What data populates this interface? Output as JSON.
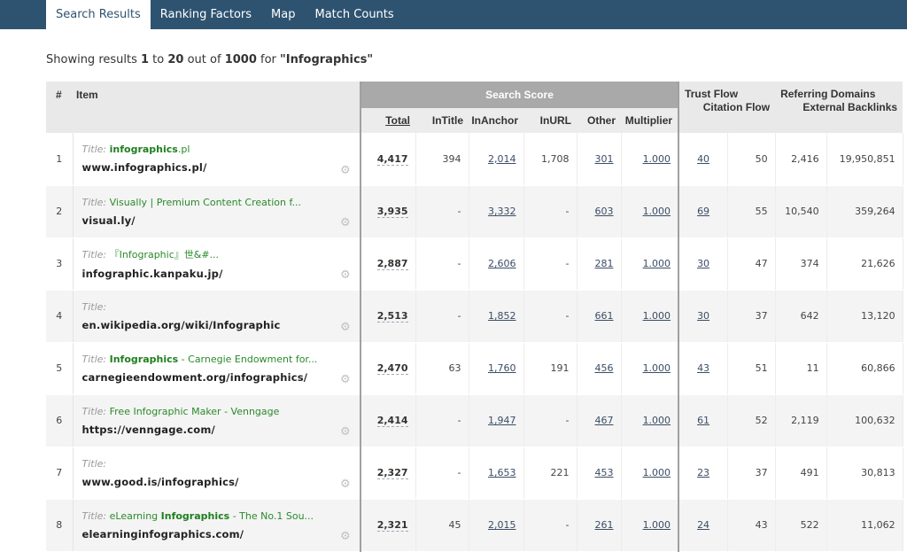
{
  "tabs": [
    {
      "label": "Search Results",
      "active": true
    },
    {
      "label": "Ranking Factors",
      "active": false
    },
    {
      "label": "Map",
      "active": false
    },
    {
      "label": "Match Counts",
      "active": false
    }
  ],
  "summary": {
    "prefix": "Showing results ",
    "from": "1",
    "to_word": " to ",
    "to": "20",
    "out_of_word": " out of ",
    "total": "1000",
    "for_word": " for ",
    "query": "\"Infographics\""
  },
  "table": {
    "headers": {
      "hash": "#",
      "item": "Item",
      "search_score": "Search Score",
      "total": "Total",
      "in_title": "InTitle",
      "in_anchor": "InAnchor",
      "in_url": "InURL",
      "other": "Other",
      "multiplier": "Multiplier",
      "trust_flow": "Trust Flow",
      "citation_flow": "Citation Flow",
      "referring_domains": "Referring Domains",
      "external_backlinks": "External Backlinks"
    },
    "title_label": "Title:",
    "rows": [
      {
        "num": "1",
        "title_parts": [
          {
            "t": "infographics",
            "b": true
          },
          {
            "t": ".pl",
            "b": false
          }
        ],
        "url": "www.infographics.pl/",
        "total": "4,417",
        "in_title": "394",
        "in_anchor": "2,014",
        "in_url": "1,708",
        "other": "301",
        "multiplier": "1.000",
        "trust_flow": "40",
        "citation_flow": "50",
        "referring_domains": "2,416",
        "external_backlinks": "19,950,851"
      },
      {
        "num": "2",
        "title_parts": [
          {
            "t": "Visually | Premium Content Creation f...",
            "b": false
          }
        ],
        "url": "visual.ly/",
        "total": "3,935",
        "in_title": "-",
        "in_anchor": "3,332",
        "in_url": "-",
        "other": "603",
        "multiplier": "1.000",
        "trust_flow": "69",
        "citation_flow": "55",
        "referring_domains": "10,540",
        "external_backlinks": "359,264"
      },
      {
        "num": "3",
        "title_parts": [
          {
            "t": "『Infographic』世&#...",
            "b": false
          }
        ],
        "url": "infographic.kanpaku.jp/",
        "total": "2,887",
        "in_title": "-",
        "in_anchor": "2,606",
        "in_url": "-",
        "other": "281",
        "multiplier": "1.000",
        "trust_flow": "30",
        "citation_flow": "47",
        "referring_domains": "374",
        "external_backlinks": "21,626"
      },
      {
        "num": "4",
        "title_parts": [],
        "url": "en.wikipedia.org/wiki/Infographic",
        "total": "2,513",
        "in_title": "-",
        "in_anchor": "1,852",
        "in_url": "-",
        "other": "661",
        "multiplier": "1.000",
        "trust_flow": "30",
        "citation_flow": "37",
        "referring_domains": "642",
        "external_backlinks": "13,120"
      },
      {
        "num": "5",
        "title_parts": [
          {
            "t": "Infographics",
            "b": true
          },
          {
            "t": " - Carnegie Endowment for...",
            "b": false
          }
        ],
        "url": "carnegieendowment.org/infographics/",
        "total": "2,470",
        "in_title": "63",
        "in_anchor": "1,760",
        "in_url": "191",
        "other": "456",
        "multiplier": "1.000",
        "trust_flow": "43",
        "citation_flow": "51",
        "referring_domains": "11",
        "external_backlinks": "60,866"
      },
      {
        "num": "6",
        "title_parts": [
          {
            "t": "Free Infographic Maker - Venngage",
            "b": false
          }
        ],
        "url": "https://venngage.com/",
        "total": "2,414",
        "in_title": "-",
        "in_anchor": "1,947",
        "in_url": "-",
        "other": "467",
        "multiplier": "1.000",
        "trust_flow": "61",
        "citation_flow": "52",
        "referring_domains": "2,119",
        "external_backlinks": "100,632"
      },
      {
        "num": "7",
        "title_parts": [],
        "url": "www.good.is/infographics/",
        "total": "2,327",
        "in_title": "-",
        "in_anchor": "1,653",
        "in_url": "221",
        "other": "453",
        "multiplier": "1.000",
        "trust_flow": "23",
        "citation_flow": "37",
        "referring_domains": "491",
        "external_backlinks": "30,813"
      },
      {
        "num": "8",
        "title_parts": [
          {
            "t": "eLearning ",
            "b": false
          },
          {
            "t": "Infographics",
            "b": true
          },
          {
            "t": " - The No.1 Sou...",
            "b": false
          }
        ],
        "url": "elearninginfographics.com/",
        "total": "2,321",
        "in_title": "45",
        "in_anchor": "2,015",
        "in_url": "-",
        "other": "261",
        "multiplier": "1.000",
        "trust_flow": "24",
        "citation_flow": "43",
        "referring_domains": "522",
        "external_backlinks": "11,062"
      }
    ]
  },
  "icons": {
    "gear": "gear-icon"
  },
  "colors": {
    "nav_bg": "#2e5370",
    "title_green": "#2a8a2a",
    "score_header_bg": "#a9a9a9"
  }
}
